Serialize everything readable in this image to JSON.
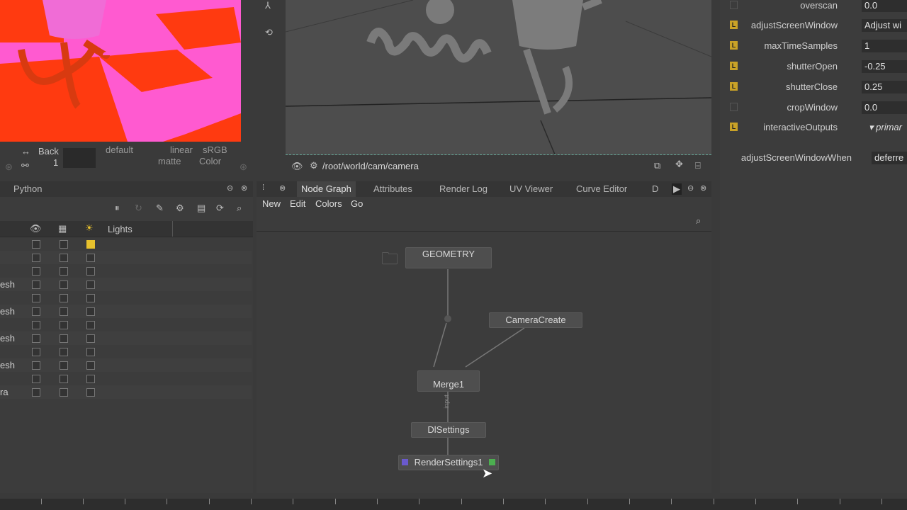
{
  "left_viewer": {
    "back_label": "Back",
    "frame": "1",
    "default_label": "default",
    "linear_label": "linear",
    "srgb_label": "sRGB",
    "matte_label": "matte",
    "color_label": "Color"
  },
  "main_viewer": {
    "camera_path": "/root/world/cam/camera"
  },
  "scenegraph": {
    "tab_label": "Python",
    "lights_header": "Lights",
    "rows": [
      {
        "name": "",
        "checked_lights": true
      },
      {
        "name": ""
      },
      {
        "name": ""
      },
      {
        "name": "esh"
      },
      {
        "name": ""
      },
      {
        "name": "esh"
      },
      {
        "name": ""
      },
      {
        "name": "esh"
      },
      {
        "name": ""
      },
      {
        "name": "esh"
      },
      {
        "name": ""
      },
      {
        "name": "ra"
      }
    ]
  },
  "node_graph": {
    "tabs": [
      "Node Graph",
      "Attributes",
      "Render Log",
      "UV Viewer",
      "Curve Editor",
      "D"
    ],
    "menu": [
      "New",
      "Edit",
      "Colors",
      "Go"
    ],
    "nodes": {
      "geometry": "GEOMETRY",
      "camera_create": "CameraCreate",
      "merge": "Merge1",
      "dlsettings": "DlSettings",
      "render_settings": "RenderSettings1",
      "input_label": "input"
    }
  },
  "properties": {
    "rows": [
      {
        "label": "overscan",
        "value": "0.0",
        "badge": false
      },
      {
        "label": "adjustScreenWindow",
        "value": "Adjust wi",
        "badge": true
      },
      {
        "label": "maxTimeSamples",
        "value": "1",
        "badge": true
      },
      {
        "label": "shutterOpen",
        "value": "-0.25",
        "badge": true
      },
      {
        "label": "shutterClose",
        "value": "0.25",
        "badge": true
      },
      {
        "label": "cropWindow",
        "value": "0.0",
        "badge": false
      },
      {
        "label": "interactiveOutputs",
        "value": "primar",
        "badge": true
      },
      {
        "label": "adjustScreenWindowWhen",
        "value": "deferre",
        "badge": false
      }
    ]
  },
  "colors": {
    "accent_yellow": "#e7c12d",
    "render_purple": "#6a5acd",
    "render_green": "#4caf50"
  }
}
